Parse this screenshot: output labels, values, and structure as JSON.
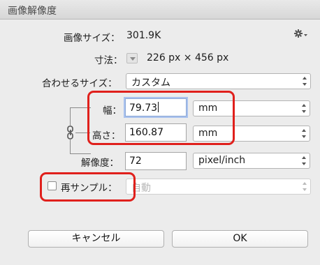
{
  "window": {
    "title": "画像解像度"
  },
  "image_size": {
    "label": "画像サイズ：",
    "value": "301.9K"
  },
  "settings_icon": "gear-icon",
  "dimensions": {
    "label": "寸法：",
    "value": "226 px × 456 px"
  },
  "fit_to": {
    "label": "合わせるサイズ：",
    "selected": "カスタム"
  },
  "width": {
    "label": "幅：",
    "value": "79.73",
    "unit": "mm"
  },
  "height": {
    "label": "高さ：",
    "value": "160.87",
    "unit": "mm"
  },
  "resolution": {
    "label": "解像度：",
    "value": "72",
    "unit": "pixel/inch"
  },
  "resample": {
    "label": "再サンプル：",
    "checked": false,
    "selected": "自動"
  },
  "buttons": {
    "cancel": "キャンセル",
    "ok": "OK"
  },
  "colors": {
    "highlight": "#e0201c",
    "focus_ring": "#a9c2ee"
  }
}
